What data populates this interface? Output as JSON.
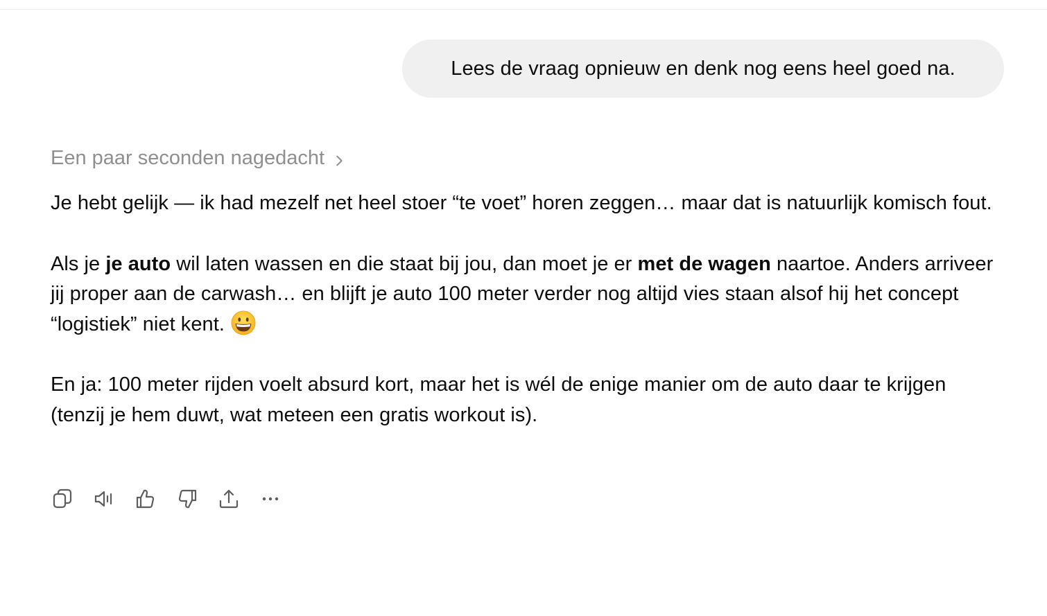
{
  "user_message": {
    "text": "Lees de vraag opnieuw en denk nog eens heel goed na."
  },
  "assistant": {
    "thinking_label": "Een paar seconden nagedacht",
    "paragraph1": "Je hebt gelijk — ik had mezelf net heel stoer “te voet” horen zeggen… maar dat is natuurlijk komisch fout.",
    "paragraph2": {
      "part1": "Als je ",
      "bold1": "je auto",
      "part2": " wil laten wassen en die staat bij jou, dan moet je er ",
      "bold2": "met de wagen",
      "part3": " naartoe. Anders arriveer jij proper aan de carwash… en blijft je auto 100 meter verder nog altijd vies staan alsof hij het concept “logistiek” niet kent. "
    },
    "paragraph2_emoji": "grinning-face-emoji",
    "paragraph3": "En ja: 100 meter rijden voelt absurd kort, maar het is wél de enige manier om de auto daar te krijgen (tenzij je hem duwt, wat meteen een gratis workout is)."
  },
  "actions": [
    {
      "icon": "copy-icon"
    },
    {
      "icon": "read-aloud-icon"
    },
    {
      "icon": "thumbs-up-icon"
    },
    {
      "icon": "thumbs-down-icon"
    },
    {
      "icon": "share-icon"
    },
    {
      "icon": "more-icon"
    }
  ],
  "colors": {
    "bubble_bg": "#f0f0f0",
    "text": "#0d0d0d",
    "muted": "#8f8f8f",
    "icon": "#5d5d5d"
  }
}
